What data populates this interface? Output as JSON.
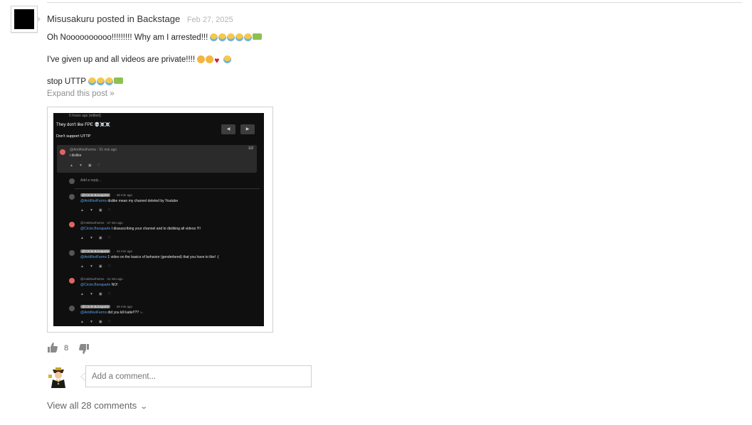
{
  "post": {
    "author": "Misusakuru",
    "posted_in_text": "posted in",
    "channel": "Backstage",
    "date": "Feb 27, 2025",
    "lines": [
      {
        "text": "Oh Noooooooooo!!!!!!!!! Why am I arrested!!!",
        "emojis": [
          "cry",
          "cry",
          "cry",
          "cry",
          "cry",
          "gun"
        ]
      },
      {
        "text": "I've given up and all videos are private!!!!",
        "emojis": [
          "meh",
          "meh",
          "heart",
          "cry"
        ]
      },
      {
        "text": "stop UTTP",
        "emojis": [
          "cry",
          "cry",
          "cry",
          "gun"
        ]
      }
    ],
    "expand_label": "Expand this post »"
  },
  "attachment": {
    "header_meta": "5 hours ago (edited)",
    "title": "They don't like FPE 💀☠️☠️",
    "subtitle": "Don't support UTTP",
    "pager": "1/2",
    "main_comment": {
      "user": "@AntiKiwiFarms · 51 min ago",
      "text": "i dislike"
    },
    "add_reply": "Add a reply...",
    "replies": [
      {
        "tag": "@Circle.Bonaparte",
        "meta": "· 48 min ago",
        "mention": "@AntiKiwiFarms",
        "text": "dislike mean my channel deleted by Youtube",
        "red": false
      },
      {
        "tag": "",
        "meta": "@AntiKiwiFarms · 47 min ago",
        "mention": "@Circle.Bonaparte",
        "text": "I dissuscribing your channel and to disliking all videos !!!!",
        "red": true
      },
      {
        "tag": "@Circle.Bonaparte",
        "meta": "· 44 min ago",
        "mention": "@AntiKiwiFarms",
        "text": "1 video on the basics of behavior (genderbend) that you have to like! :(",
        "red": false
      },
      {
        "tag": "",
        "meta": "@AntiKiwiFarms · 41 min ago",
        "mention": "@Circle.Bonaparte",
        "text": "NO!",
        "red": true
      },
      {
        "tag": "@Circle.Bonaparte",
        "meta": "· 39 min ago",
        "mention": "@AntiKiwiFarms",
        "text": "did you kill katie!!?? :-.",
        "red": false
      }
    ]
  },
  "reactions": {
    "likes": "8"
  },
  "comment_placeholder": "Add a comment...",
  "view_all_label": "View all 28 comments",
  "colors": {
    "date": "#b5b5b5",
    "link_muted": "#8f8f8f",
    "mention": "#5aa0e8"
  }
}
